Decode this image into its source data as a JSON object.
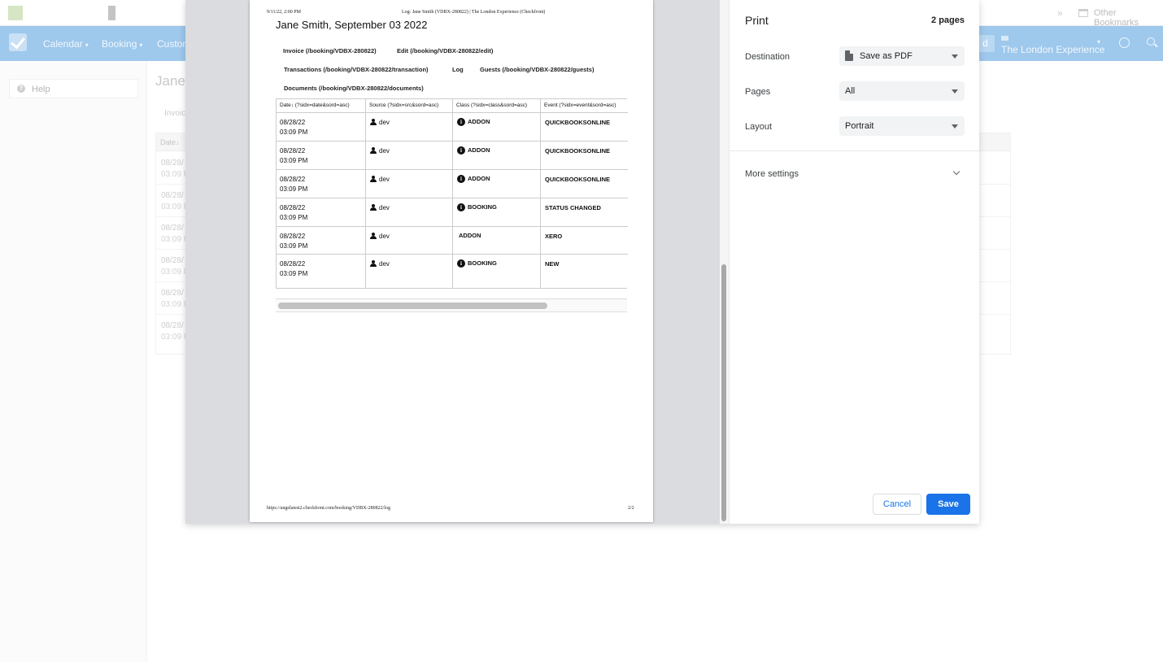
{
  "bookmarks": {
    "overflow_chevron": "»",
    "other_bookmarks": "Other Bookmarks"
  },
  "app_nav": {
    "items": [
      {
        "label": "Calendar",
        "caret": "▾"
      },
      {
        "label": "Booking",
        "caret": "▾"
      },
      {
        "label": "Custom",
        "caret": ""
      }
    ],
    "user_initial": "d",
    "account_name": "The London Experience",
    "account_caret": "▾"
  },
  "app_sidebar": {
    "help_label": "Help",
    "help_icon_glyph": "?"
  },
  "app_main": {
    "title": "Jane",
    "tab": "Invoic",
    "date_header": "Date↓",
    "rows": [
      {
        "date": "08/28/",
        "time": "03:09 P"
      },
      {
        "date": "08/28/",
        "time": "03:09 P"
      },
      {
        "date": "08/28/",
        "time": "03:09 P"
      },
      {
        "date": "08/28/",
        "time": "03:09 P"
      },
      {
        "date": "08/28/",
        "time": "03:09 P"
      },
      {
        "date": "08/28/",
        "time": "03:09 P"
      }
    ]
  },
  "preview": {
    "header_left": "9/11/22, 2:00 PM",
    "header_center": "Log: Jane Smith (VDBX-280822) | The London Experience (Checkfront)",
    "title": "Jane Smith, September 03 2022",
    "links": {
      "invoice": "Invoice (/booking/VDBX-280822)",
      "edit": "Edit (/booking/VDBX-280822/edit)",
      "transactions": "Transactions (/booking/VDBX-280822/transaction)",
      "log": "Log",
      "guests": "Guests (/booking/VDBX-280822/guests)",
      "documents": "Documents (/booking/VDBX-280822/documents)"
    },
    "table": {
      "headers": [
        "Date↓ (?sidx=date&sord=asc)",
        "Source (?sidx=src&sord=asc)",
        "Class (?sidx=class&sord=asc)",
        "Event (?sidx=event&sord=asc)"
      ],
      "rows": [
        {
          "date": "08/28/22",
          "time": "03:09 PM",
          "source": "dev",
          "class": "ADDON",
          "event": "QUICKBOOKSONLINE",
          "class_icon": "i"
        },
        {
          "date": "08/28/22",
          "time": "03:09 PM",
          "source": "dev",
          "class": "ADDON",
          "event": "QUICKBOOKSONLINE",
          "class_icon": "i"
        },
        {
          "date": "08/28/22",
          "time": "03:09 PM",
          "source": "dev",
          "class": "ADDON",
          "event": "QUICKBOOKSONLINE",
          "class_icon": "i"
        },
        {
          "date": "08/28/22",
          "time": "03:09 PM",
          "source": "dev",
          "class": "BOOKING",
          "event": "STATUS CHANGED",
          "class_icon": "i"
        },
        {
          "date": "08/28/22",
          "time": "03:09 PM",
          "source": "dev",
          "class": "ADDON",
          "event": "XERO",
          "class_icon": ""
        },
        {
          "date": "08/28/22",
          "time": "03:09 PM",
          "source": "dev",
          "class": "BOOKING",
          "event": "NEW",
          "class_icon": "i"
        }
      ]
    },
    "footer_left": "https://angelatest2.checkfront.com/booking/VDBX-280822/log",
    "footer_right": "2/2"
  },
  "print_settings": {
    "title": "Print",
    "page_count": "2 pages",
    "destination_label": "Destination",
    "destination_value": "Save as PDF",
    "pages_label": "Pages",
    "pages_value": "All",
    "layout_label": "Layout",
    "layout_value": "Portrait",
    "more_settings": "More settings",
    "cancel_label": "Cancel",
    "save_label": "Save"
  },
  "colors": {
    "nav_bar": "#9ec8ec",
    "primary_button": "#1a73e8",
    "preview_background": "#dadce0"
  }
}
